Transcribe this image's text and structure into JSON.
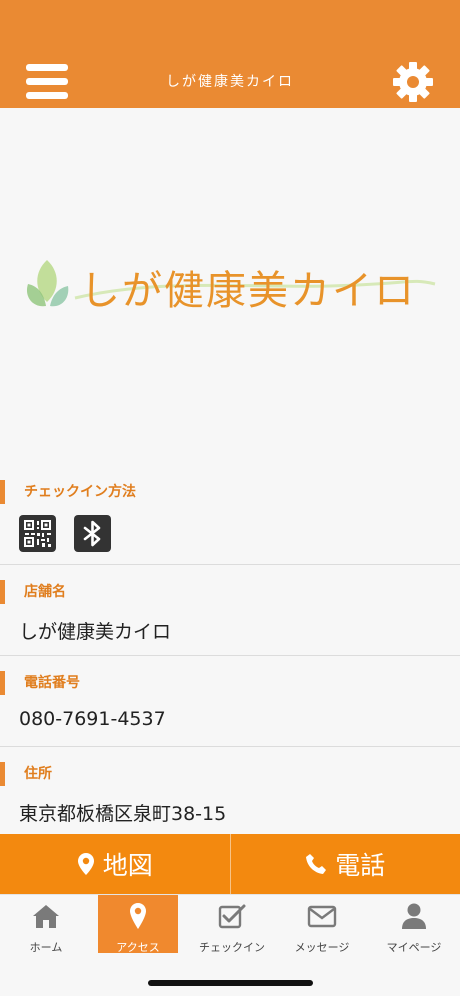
{
  "header": {
    "title": "しが健康美カイロ",
    "menu_icon": "hamburger-menu-icon",
    "settings_icon": "gear-icon",
    "bg_color": "#ea8a33"
  },
  "logo": {
    "text": "しが健康美カイロ",
    "color": "#e8932a"
  },
  "sections": {
    "checkin": {
      "label": "チェックイン方法",
      "icons": [
        "qr-code-icon",
        "bluetooth-icon"
      ]
    },
    "store": {
      "label": "店舗名",
      "value": "しが健康美カイロ"
    },
    "phone": {
      "label": "電話番号",
      "value": "080-7691-4537"
    },
    "address": {
      "label": "住所",
      "value": "東京都板橋区泉町38-15"
    }
  },
  "actions": {
    "map_label": "地図",
    "call_label": "電話",
    "bg_color": "#f3890f"
  },
  "tabs": [
    {
      "label": "ホーム",
      "icon": "home-icon"
    },
    {
      "label": "アクセス",
      "icon": "map-pin-icon",
      "active": true
    },
    {
      "label": "チェックイン",
      "icon": "checkbox-icon"
    },
    {
      "label": "メッセージ",
      "icon": "envelope-icon"
    },
    {
      "label": "マイページ",
      "icon": "user-icon"
    }
  ]
}
